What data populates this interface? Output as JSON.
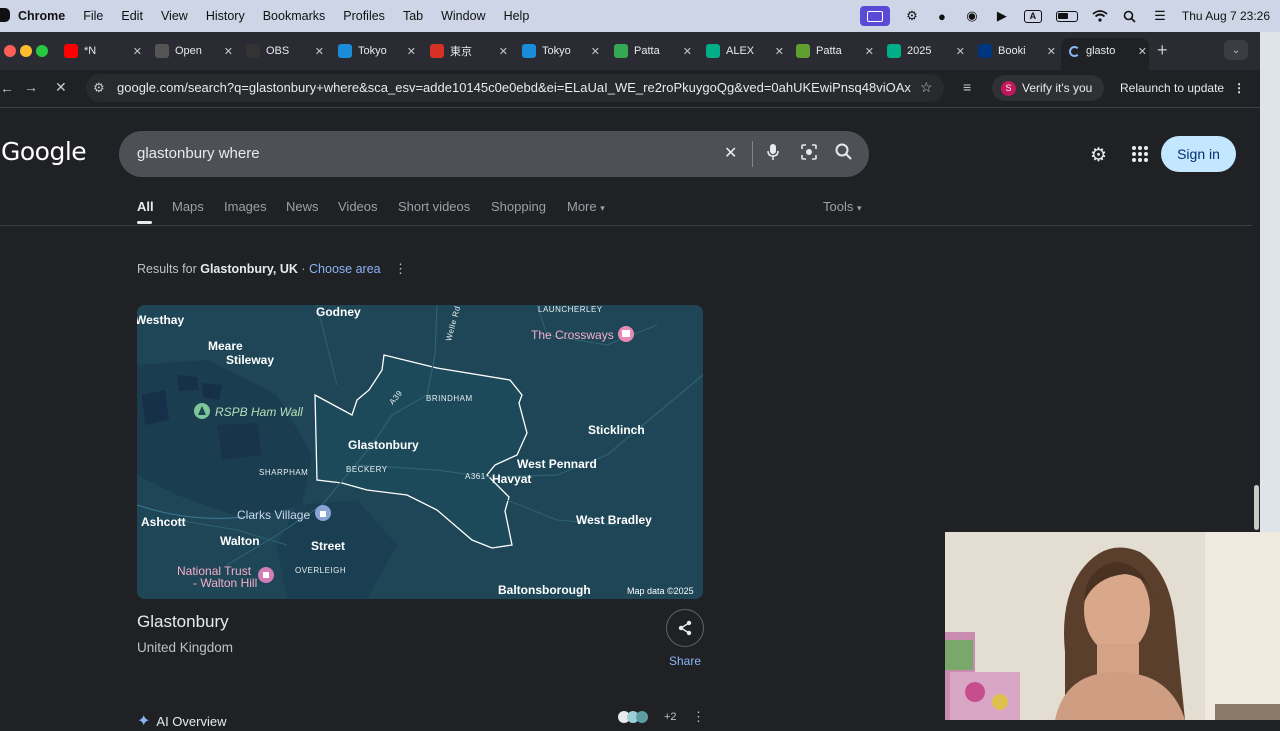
{
  "menubar": {
    "app_name": "Chrome",
    "items": [
      "File",
      "Edit",
      "View",
      "History",
      "Bookmarks",
      "Profiles",
      "Tab",
      "Window",
      "Help"
    ],
    "clock": "Thu Aug 7  23:26",
    "input_indicator": "A"
  },
  "tabs": [
    {
      "title": "*N",
      "favicon": "youtube-icon",
      "color": "#ff0000"
    },
    {
      "title": "Open",
      "favicon": "openai-icon",
      "color": "#555555"
    },
    {
      "title": "OBS",
      "favicon": "obs-icon",
      "color": "#333333"
    },
    {
      "title": "Tokyo",
      "favicon": "web-icon",
      "color": "#1a8cd8"
    },
    {
      "title": "東京",
      "favicon": "restaurant-icon",
      "color": "#d93025"
    },
    {
      "title": "Tokyo",
      "favicon": "web-icon",
      "color": "#1a8cd8"
    },
    {
      "title": "Patta",
      "favicon": "map-pin-icon",
      "color": "#34a853"
    },
    {
      "title": "ALEX",
      "favicon": "tripadvisor-icon",
      "color": "#00af87"
    },
    {
      "title": "Patta",
      "favicon": "palm-icon",
      "color": "#5f9e2f"
    },
    {
      "title": "2025",
      "favicon": "tripadvisor-icon",
      "color": "#00af87"
    },
    {
      "title": "Booki",
      "favicon": "booking-icon",
      "color": "#003580"
    },
    {
      "title": "glasto",
      "favicon": "loading-icon",
      "color": "#202124",
      "active": true
    }
  ],
  "toolbar": {
    "url": "google.com/search?q=glastonbury+where&sca_esv=adde10145c0e0ebd&ei=ELaUaI_WE_re2roPkuygoQg&ved=0ahUKEwiPnsq48viOAx...",
    "verify_label": "Verify it's you",
    "relaunch_label": "Relaunch to update"
  },
  "google": {
    "logo": "Google",
    "query": "glastonbury where",
    "sign_in": "Sign in",
    "nav_tabs": [
      "All",
      "Maps",
      "Images",
      "News",
      "Videos",
      "Short videos",
      "Shopping",
      "More"
    ],
    "tools": "Tools",
    "results_for_prefix": "Results for ",
    "results_for_place": "Glastonbury, UK",
    "choose_area": "Choose area"
  },
  "map": {
    "labels": [
      {
        "text": "Westhay",
        "style": "bold"
      },
      {
        "text": "Godney",
        "style": "bold"
      },
      {
        "text": "LAUNCHERLEY",
        "style": "small"
      },
      {
        "text": "The Crossways",
        "style": "pink"
      },
      {
        "text": "Welle Rd",
        "style": "small"
      },
      {
        "text": "Meare",
        "style": "bold"
      },
      {
        "text": "Stileway",
        "style": "bold"
      },
      {
        "text": "A39",
        "style": "small"
      },
      {
        "text": "BRINDHAM",
        "style": "small"
      },
      {
        "text": "RSPB Ham Wall",
        "style": "green"
      },
      {
        "text": "Sticklinch",
        "style": "bold"
      },
      {
        "text": "Glastonbury",
        "style": "bold"
      },
      {
        "text": "BECKERY",
        "style": "small"
      },
      {
        "text": "West Pennard",
        "style": "bold"
      },
      {
        "text": "SHARPHAM",
        "style": "small"
      },
      {
        "text": "A361",
        "style": "small"
      },
      {
        "text": "Havyat",
        "style": "bold"
      },
      {
        "text": "Clarks Village",
        "style": "blue"
      },
      {
        "text": "Ashcott",
        "style": "bold"
      },
      {
        "text": "West Bradley",
        "style": "bold"
      },
      {
        "text": "Walton",
        "style": "bold"
      },
      {
        "text": "Street",
        "style": "bold"
      },
      {
        "text": "National Trust",
        "style": "pink"
      },
      {
        "text": "- Walton Hill",
        "style": "pink"
      },
      {
        "text": "OVERLEIGH",
        "style": "small"
      },
      {
        "text": "Baltonsborough",
        "style": "bold"
      }
    ],
    "attribution": "Map data ©2025"
  },
  "place": {
    "title": "Glastonbury",
    "subtitle": "United Kingdom",
    "share_label": "Share"
  },
  "ai_overview": {
    "label": "AI Overview",
    "source_count": "+2"
  }
}
